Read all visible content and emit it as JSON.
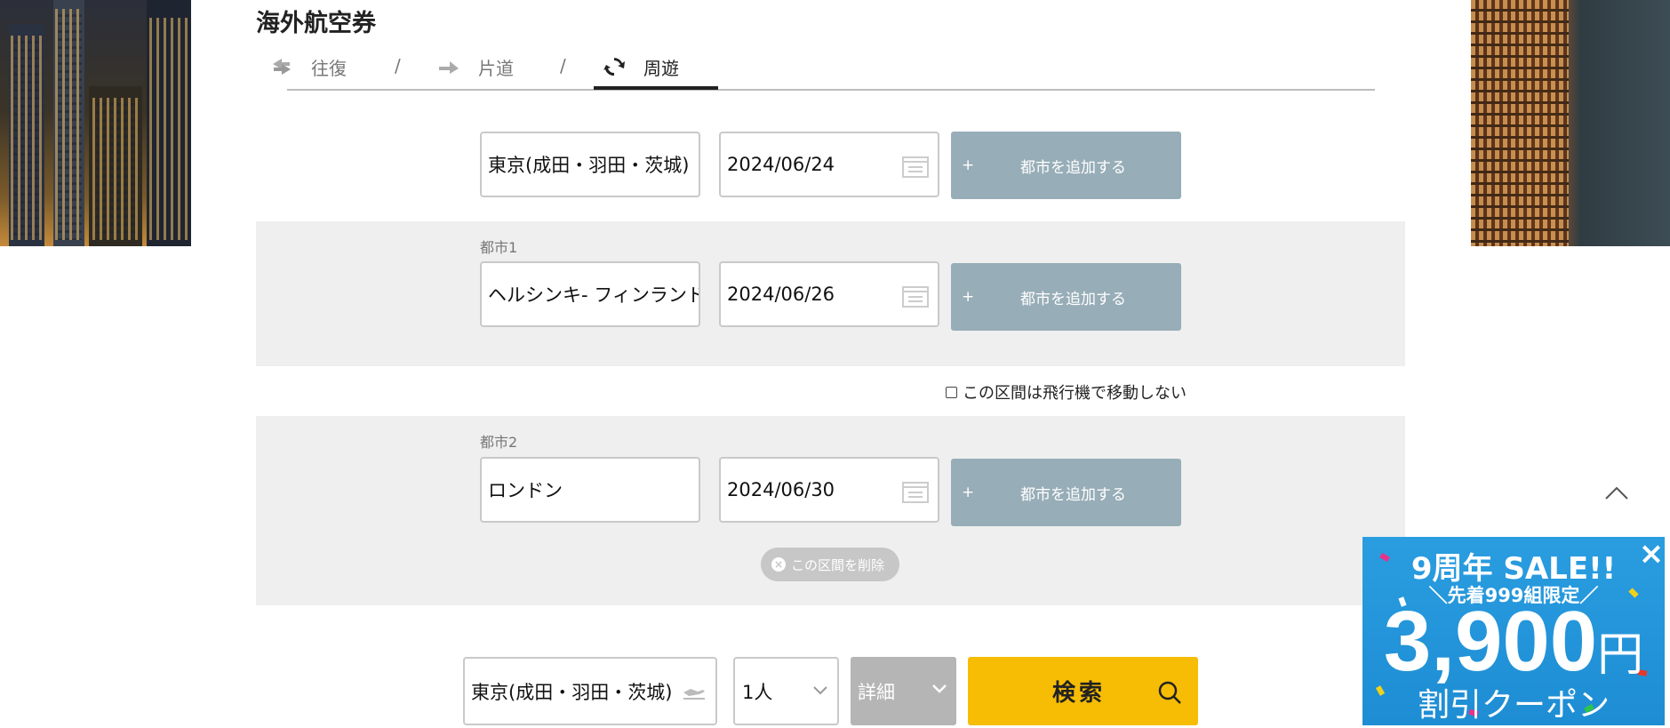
{
  "header": {
    "title": "海外航空券"
  },
  "tabs": [
    {
      "label": "往復",
      "icon": "round-trip-icon"
    },
    {
      "label": "片道",
      "icon": "one-way-icon"
    },
    {
      "label": "周遊",
      "icon": "multi-city-icon",
      "active": true
    }
  ],
  "tab_separator": "/",
  "origin_row": {
    "city_value": "東京(成田・羽田・茨城)",
    "date_value": "2024/06/24",
    "add_city_plus": "+",
    "add_city_label": "都市を追加する"
  },
  "city1": {
    "label": "都市1",
    "city_value": "ヘルシンキ- フィンランド",
    "date_value": "2024/06/26",
    "add_city_plus": "+",
    "add_city_label": "都市を追加する"
  },
  "no_flight_checkbox": {
    "label": "この区間は飛行機で移動しない",
    "checked": false
  },
  "city2": {
    "label": "都市2",
    "city_value": "ロンドン",
    "date_value": "2024/06/30",
    "add_city_plus": "+",
    "add_city_label": "都市を追加する",
    "delete_label": "この区間を削除"
  },
  "bottom": {
    "return_city": "東京(成田・羽田・茨城)",
    "passengers": "1人",
    "detail_label": "詳細",
    "search_label": "検索"
  },
  "promo": {
    "title": "9周年 SALE!!",
    "sub": "＼先着999組限定／",
    "amount": "3,900",
    "unit": "円",
    "coupon": "割引クーポン"
  },
  "colors": {
    "add_button": "#97adb7",
    "search_button": "#f6bd04",
    "promo_bg": "#1e8dd4"
  }
}
